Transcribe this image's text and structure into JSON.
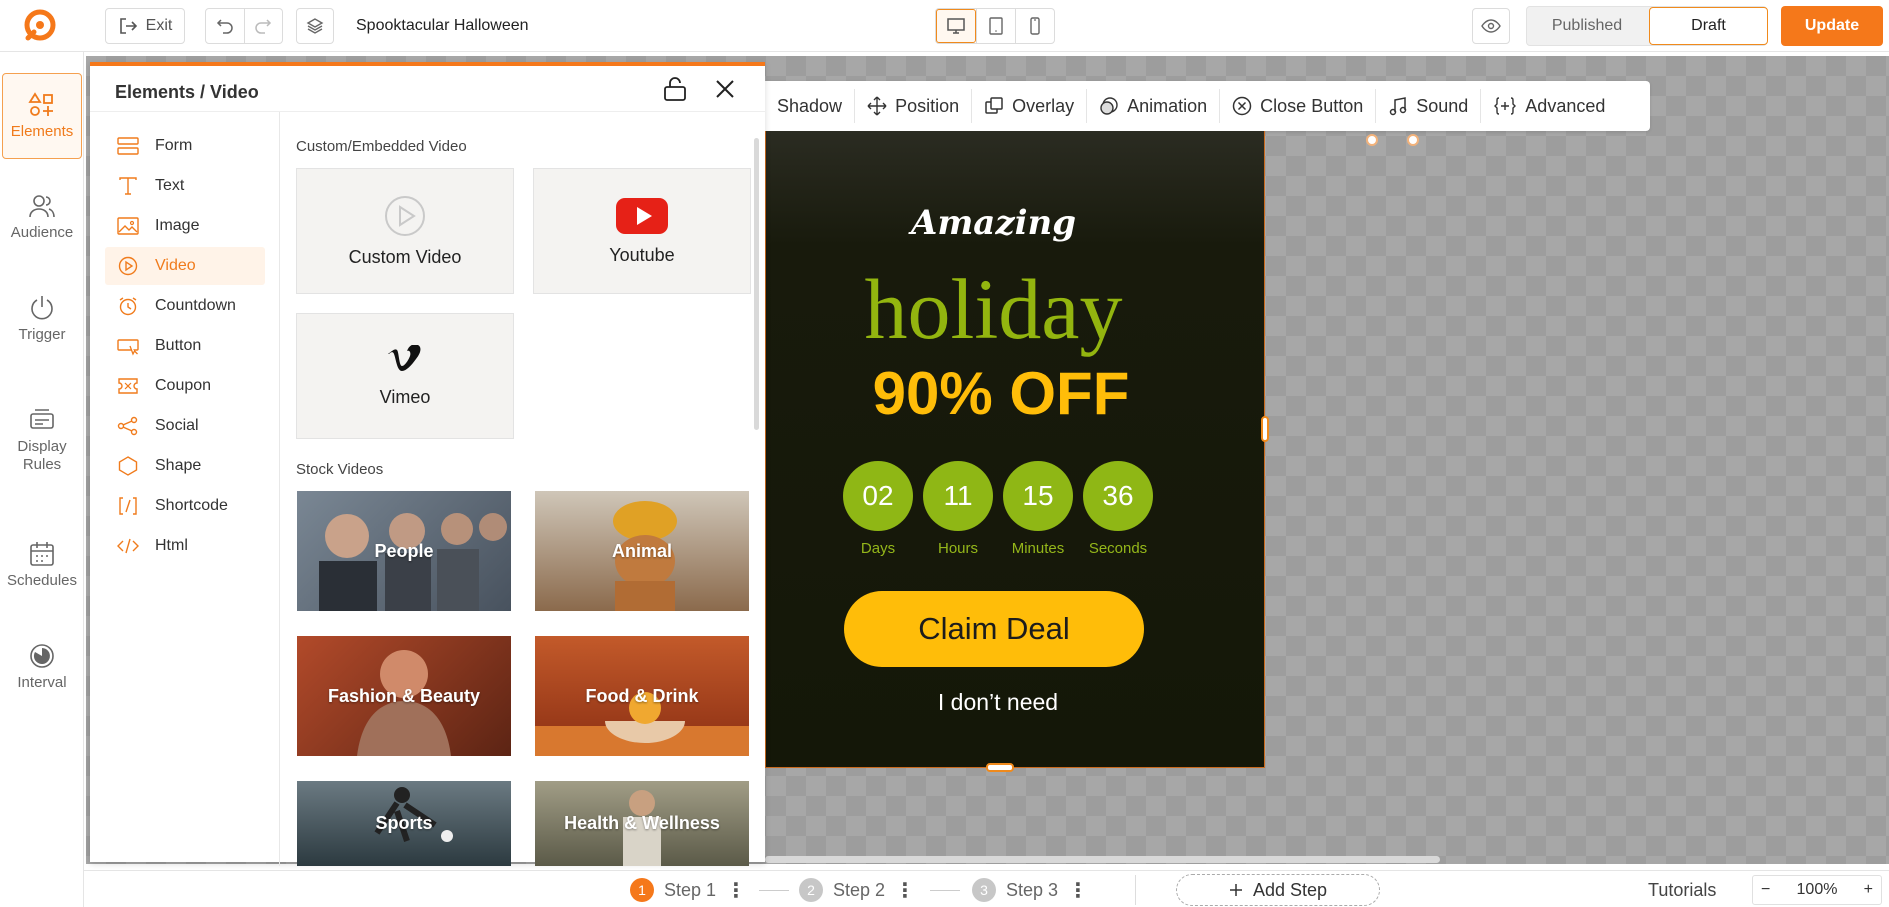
{
  "topbar": {
    "exit_label": "Exit",
    "campaign_title": "Spooktacular Halloween",
    "published_label": "Published",
    "draft_label": "Draft",
    "update_label": "Update"
  },
  "rail": {
    "items": [
      {
        "label": "Elements",
        "icon": "elements-icon"
      },
      {
        "label": "Audience",
        "icon": "audience-icon"
      },
      {
        "label": "Trigger",
        "icon": "power-icon"
      },
      {
        "label": "Display\nRules",
        "icon": "display-rules-icon"
      },
      {
        "label": "Schedules",
        "icon": "calendar-icon"
      },
      {
        "label": "Interval",
        "icon": "interval-icon"
      }
    ]
  },
  "panel": {
    "title": "Elements / Video",
    "elements": [
      {
        "label": "Form",
        "icon": "form-icon"
      },
      {
        "label": "Text",
        "icon": "text-icon"
      },
      {
        "label": "Image",
        "icon": "image-icon"
      },
      {
        "label": "Video",
        "icon": "video-icon"
      },
      {
        "label": "Countdown",
        "icon": "countdown-icon"
      },
      {
        "label": "Button",
        "icon": "button-icon"
      },
      {
        "label": "Coupon",
        "icon": "coupon-icon"
      },
      {
        "label": "Social",
        "icon": "social-icon"
      },
      {
        "label": "Shape",
        "icon": "shape-icon"
      },
      {
        "label": "Shortcode",
        "icon": "shortcode-icon"
      },
      {
        "label": "Html",
        "icon": "html-icon"
      }
    ],
    "custom_section_label": "Custom/Embedded Video",
    "custom_cards": [
      {
        "label": "Custom Video",
        "icon": "play-circle-icon"
      },
      {
        "label": "Youtube",
        "icon": "youtube-icon"
      },
      {
        "label": "Vimeo",
        "icon": "vimeo-icon"
      }
    ],
    "stock_section_label": "Stock Videos",
    "stock_videos": [
      {
        "label": "People",
        "color": "#5d6a78"
      },
      {
        "label": "Animal",
        "color": "#a98660"
      },
      {
        "label": "Fashion & Beauty",
        "color": "#8a3b22"
      },
      {
        "label": "Food & Drink",
        "color": "#9a3b1c"
      },
      {
        "label": "Sports",
        "color": "#3e4d55"
      },
      {
        "label": "Health & Wellness",
        "color": "#7d7a63"
      }
    ]
  },
  "canvas_toolbar": {
    "items": [
      {
        "label": "Shadow",
        "icon": ""
      },
      {
        "label": "Position",
        "icon": "move-icon"
      },
      {
        "label": "Overlay",
        "icon": "overlay-icon"
      },
      {
        "label": "Animation",
        "icon": "animation-icon"
      },
      {
        "label": "Close Button",
        "icon": "close-circle-icon"
      },
      {
        "label": "Sound",
        "icon": "music-note-icon"
      },
      {
        "label": "Advanced",
        "icon": "advanced-icon"
      }
    ]
  },
  "popup": {
    "brand": "Amazing",
    "headline": "holiday",
    "offer": "90% OFF",
    "countdown": [
      {
        "value": "02",
        "unit": "Days"
      },
      {
        "value": "11",
        "unit": "Hours"
      },
      {
        "value": "15",
        "unit": "Minutes"
      },
      {
        "value": "36",
        "unit": "Seconds"
      }
    ],
    "cta_label": "Claim Deal",
    "decline_label": "I don’t need",
    "colors": {
      "accent_green": "#93b50f",
      "accent_yellow": "#ffbd09"
    }
  },
  "bottombar": {
    "steps": [
      {
        "num": "1",
        "label": "Step 1"
      },
      {
        "num": "2",
        "label": "Step 2"
      },
      {
        "num": "3",
        "label": "Step 3"
      }
    ],
    "add_step_label": "Add Step",
    "tutorials_label": "Tutorials",
    "zoom_level": "100%",
    "zoom_minus": "−",
    "zoom_plus": "+"
  },
  "colors": {
    "brand_orange": "#f5781a"
  }
}
